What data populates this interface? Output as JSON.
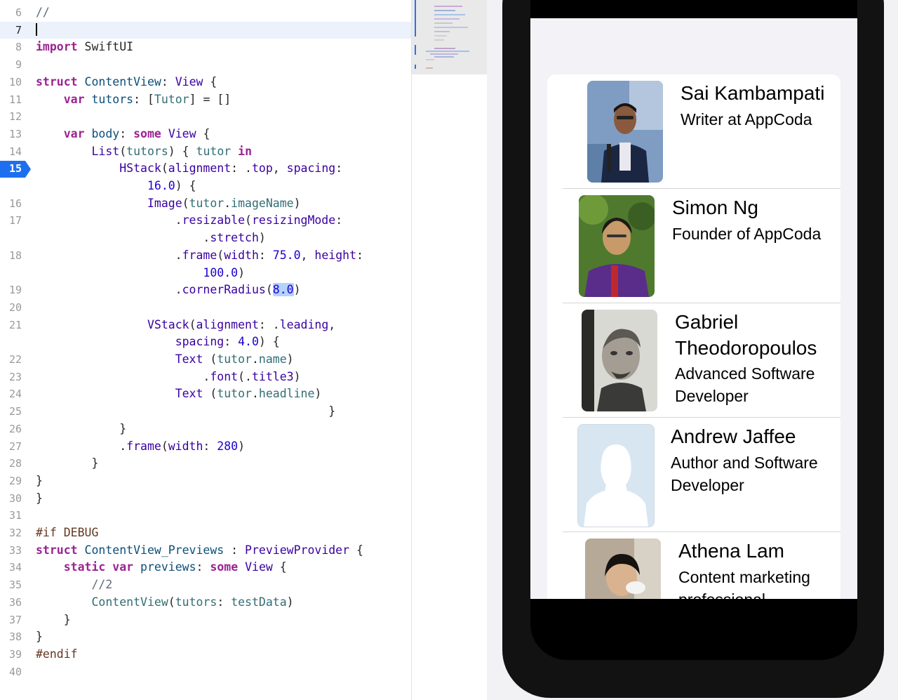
{
  "editor": {
    "lines": [
      {
        "num": "6",
        "tokens": [
          {
            "t": "//",
            "c": "cm"
          }
        ]
      },
      {
        "num": "7",
        "tokens": [],
        "caret": true,
        "active": true
      },
      {
        "num": "8",
        "tokens": [
          {
            "t": "import",
            "c": "kw"
          },
          {
            "t": " SwiftUI"
          }
        ]
      },
      {
        "num": "9",
        "tokens": []
      },
      {
        "num": "10",
        "tokens": [
          {
            "t": "struct",
            "c": "kw"
          },
          {
            "t": " "
          },
          {
            "t": "ContentView",
            "c": "tyu"
          },
          {
            "t": ": "
          },
          {
            "t": "View",
            "c": "ty"
          },
          {
            "t": " {"
          }
        ]
      },
      {
        "num": "11",
        "tokens": [
          {
            "t": "    "
          },
          {
            "t": "var",
            "c": "kw"
          },
          {
            "t": " "
          },
          {
            "t": "tutors",
            "c": "tyu"
          },
          {
            "t": ": ["
          },
          {
            "t": "Tutor",
            "c": "fn"
          },
          {
            "t": "] = []"
          }
        ]
      },
      {
        "num": "12",
        "tokens": []
      },
      {
        "num": "13",
        "tokens": [
          {
            "t": "    "
          },
          {
            "t": "var",
            "c": "kw"
          },
          {
            "t": " "
          },
          {
            "t": "body",
            "c": "tyu"
          },
          {
            "t": ": "
          },
          {
            "t": "some",
            "c": "kw"
          },
          {
            "t": " "
          },
          {
            "t": "View",
            "c": "ty"
          },
          {
            "t": " {"
          }
        ]
      },
      {
        "num": "14",
        "tokens": [
          {
            "t": "        "
          },
          {
            "t": "List",
            "c": "ty"
          },
          {
            "t": "("
          },
          {
            "t": "tutors",
            "c": "fn"
          },
          {
            "t": ") { "
          },
          {
            "t": "tutor",
            "c": "fn"
          },
          {
            "t": " "
          },
          {
            "t": "in",
            "c": "kw"
          }
        ]
      },
      {
        "num": "15",
        "tokens": [
          {
            "t": "            "
          },
          {
            "t": "HStack",
            "c": "ty"
          },
          {
            "t": "("
          },
          {
            "t": "alignment",
            "c": "ty"
          },
          {
            "t": ": ."
          },
          {
            "t": "top",
            "c": "ty"
          },
          {
            "t": ", "
          },
          {
            "t": "spacing",
            "c": "ty"
          },
          {
            "t": ":"
          }
        ],
        "breakpoint": true
      },
      {
        "num": "",
        "tokens": [
          {
            "t": "                "
          },
          {
            "t": "16.0",
            "c": "num"
          },
          {
            "t": ") {"
          }
        ]
      },
      {
        "num": "16",
        "tokens": [
          {
            "t": "                "
          },
          {
            "t": "Image",
            "c": "ty"
          },
          {
            "t": "("
          },
          {
            "t": "tutor",
            "c": "fn"
          },
          {
            "t": "."
          },
          {
            "t": "imageName",
            "c": "fn"
          },
          {
            "t": ")"
          }
        ]
      },
      {
        "num": "17",
        "tokens": [
          {
            "t": "                    ."
          },
          {
            "t": "resizable",
            "c": "ty"
          },
          {
            "t": "("
          },
          {
            "t": "resizingMode",
            "c": "ty"
          },
          {
            "t": ":"
          }
        ]
      },
      {
        "num": "",
        "tokens": [
          {
            "t": "                        ."
          },
          {
            "t": "stretch",
            "c": "ty"
          },
          {
            "t": ")"
          }
        ]
      },
      {
        "num": "18",
        "tokens": [
          {
            "t": "                    ."
          },
          {
            "t": "frame",
            "c": "ty"
          },
          {
            "t": "("
          },
          {
            "t": "width",
            "c": "ty"
          },
          {
            "t": ": "
          },
          {
            "t": "75.0",
            "c": "num"
          },
          {
            "t": ", "
          },
          {
            "t": "height",
            "c": "ty"
          },
          {
            "t": ":"
          }
        ]
      },
      {
        "num": "",
        "tokens": [
          {
            "t": "                        "
          },
          {
            "t": "100.0",
            "c": "num"
          },
          {
            "t": ")"
          }
        ]
      },
      {
        "num": "19",
        "tokens": [
          {
            "t": "                    ."
          },
          {
            "t": "cornerRadius",
            "c": "ty"
          },
          {
            "t": "("
          },
          {
            "t": "8.0",
            "c": "num sel"
          },
          {
            "t": ")"
          }
        ]
      },
      {
        "num": "20",
        "tokens": []
      },
      {
        "num": "21",
        "tokens": [
          {
            "t": "                "
          },
          {
            "t": "VStack",
            "c": "ty"
          },
          {
            "t": "("
          },
          {
            "t": "alignment",
            "c": "ty"
          },
          {
            "t": ": ."
          },
          {
            "t": "leading",
            "c": "ty"
          },
          {
            "t": ","
          }
        ]
      },
      {
        "num": "",
        "tokens": [
          {
            "t": "                    "
          },
          {
            "t": "spacing",
            "c": "ty"
          },
          {
            "t": ": "
          },
          {
            "t": "4.0",
            "c": "num"
          },
          {
            "t": ") {"
          }
        ]
      },
      {
        "num": "22",
        "tokens": [
          {
            "t": "                    "
          },
          {
            "t": "Text",
            "c": "ty"
          },
          {
            "t": " ("
          },
          {
            "t": "tutor",
            "c": "fn"
          },
          {
            "t": "."
          },
          {
            "t": "name",
            "c": "fn"
          },
          {
            "t": ")"
          }
        ]
      },
      {
        "num": "23",
        "tokens": [
          {
            "t": "                        ."
          },
          {
            "t": "font",
            "c": "ty"
          },
          {
            "t": "(."
          },
          {
            "t": "title3",
            "c": "ty"
          },
          {
            "t": ")"
          }
        ]
      },
      {
        "num": "24",
        "tokens": [
          {
            "t": "                    "
          },
          {
            "t": "Text",
            "c": "ty"
          },
          {
            "t": " ("
          },
          {
            "t": "tutor",
            "c": "fn"
          },
          {
            "t": "."
          },
          {
            "t": "headline",
            "c": "fn"
          },
          {
            "t": ")"
          }
        ]
      },
      {
        "num": "25",
        "tokens": [
          {
            "t": "                                          }"
          }
        ]
      },
      {
        "num": "26",
        "tokens": [
          {
            "t": "            }"
          }
        ]
      },
      {
        "num": "27",
        "tokens": [
          {
            "t": "            ."
          },
          {
            "t": "frame",
            "c": "ty"
          },
          {
            "t": "("
          },
          {
            "t": "width",
            "c": "ty"
          },
          {
            "t": ": "
          },
          {
            "t": "280",
            "c": "num"
          },
          {
            "t": ")"
          }
        ]
      },
      {
        "num": "28",
        "tokens": [
          {
            "t": "        }"
          }
        ]
      },
      {
        "num": "29",
        "tokens": [
          {
            "t": "}"
          }
        ]
      },
      {
        "num": "30",
        "tokens": [
          {
            "t": "}"
          }
        ]
      },
      {
        "num": "31",
        "tokens": []
      },
      {
        "num": "32",
        "tokens": [
          {
            "t": "#if DEBUG",
            "c": "pp"
          }
        ]
      },
      {
        "num": "33",
        "tokens": [
          {
            "t": "struct",
            "c": "kw"
          },
          {
            "t": " "
          },
          {
            "t": "ContentView_Previews",
            "c": "tyu"
          },
          {
            "t": " : "
          },
          {
            "t": "PreviewProvider",
            "c": "ty"
          },
          {
            "t": " {"
          }
        ]
      },
      {
        "num": "34",
        "tokens": [
          {
            "t": "    "
          },
          {
            "t": "static",
            "c": "kw"
          },
          {
            "t": " "
          },
          {
            "t": "var",
            "c": "kw"
          },
          {
            "t": " "
          },
          {
            "t": "previews",
            "c": "tyu"
          },
          {
            "t": ": "
          },
          {
            "t": "some",
            "c": "kw"
          },
          {
            "t": " "
          },
          {
            "t": "View",
            "c": "ty"
          },
          {
            "t": " {"
          }
        ]
      },
      {
        "num": "35",
        "tokens": [
          {
            "t": "        "
          },
          {
            "t": "//2",
            "c": "cm"
          }
        ]
      },
      {
        "num": "36",
        "tokens": [
          {
            "t": "        "
          },
          {
            "t": "ContentView",
            "c": "fn"
          },
          {
            "t": "("
          },
          {
            "t": "tutors",
            "c": "fn"
          },
          {
            "t": ": "
          },
          {
            "t": "testData",
            "c": "fn"
          },
          {
            "t": ")"
          }
        ]
      },
      {
        "num": "37",
        "tokens": [
          {
            "t": "    }"
          }
        ]
      },
      {
        "num": "38",
        "tokens": [
          {
            "t": "}"
          }
        ]
      },
      {
        "num": "39",
        "tokens": [
          {
            "t": "#endif",
            "c": "pp"
          }
        ]
      },
      {
        "num": "40",
        "tokens": []
      }
    ]
  },
  "preview": {
    "tutors": [
      {
        "name": "Sai Kambampati",
        "headline": "Writer at AppCoda"
      },
      {
        "name": "Simon Ng",
        "headline": "Founder of AppCoda"
      },
      {
        "name": "Gabriel Theodoropoulos",
        "headline": "Advanced Software Developer"
      },
      {
        "name": "Andrew Jaffee",
        "headline": "Author and Software Developer"
      },
      {
        "name": "Athena Lam",
        "headline": "Content marketing professional"
      }
    ]
  },
  "colors": {
    "breakpoint": "#1e6ff0",
    "list_background": "#f2f2f7"
  }
}
